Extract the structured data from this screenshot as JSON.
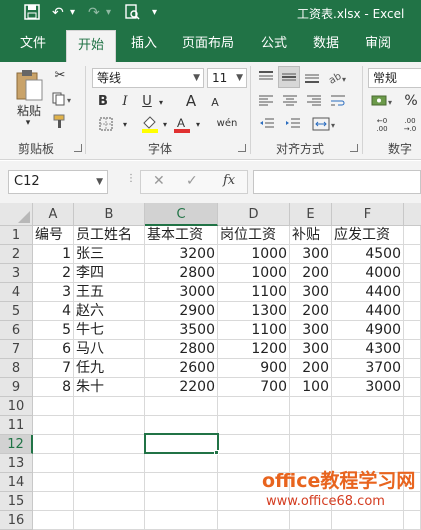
{
  "window": {
    "title": "工资表.xlsx - Excel"
  },
  "quick_access": {
    "save": "save-icon",
    "undo": "undo-icon",
    "redo": "redo-icon",
    "preview": "print-preview-icon",
    "customize": "▾"
  },
  "tabs": [
    {
      "label": "文件"
    },
    {
      "label": "开始"
    },
    {
      "label": "插入"
    },
    {
      "label": "页面布局"
    },
    {
      "label": "公式"
    },
    {
      "label": "数据"
    },
    {
      "label": "审阅"
    }
  ],
  "ribbon": {
    "clipboard": {
      "paste_label": "粘贴",
      "group_label": "剪贴板"
    },
    "font": {
      "font_name": "等线",
      "font_size": "11",
      "bold": "B",
      "italic": "I",
      "underline": "U",
      "size_up": "A",
      "size_down": "A",
      "phonetic": "wén",
      "group_label": "字体"
    },
    "alignment": {
      "group_label": "对齐方式"
    },
    "number": {
      "format": "常规",
      "percent": "%",
      "group_label": "数字"
    }
  },
  "formula_bar": {
    "name_box": "C12",
    "fx": "fx",
    "cancel": "✕",
    "enter": "✓",
    "content": ""
  },
  "sheet": {
    "columns": [
      "A",
      "B",
      "C",
      "D",
      "E",
      "F"
    ],
    "row_numbers": [
      "1",
      "2",
      "3",
      "4",
      "5",
      "6",
      "7",
      "8",
      "9",
      "10",
      "11",
      "12",
      "13",
      "14",
      "15",
      "16"
    ],
    "header": [
      "编号",
      "员工姓名",
      "基本工资",
      "岗位工资",
      "补贴",
      "应发工资"
    ],
    "rows": [
      [
        "1",
        "张三",
        "3200",
        "1000",
        "300",
        "4500"
      ],
      [
        "2",
        "李四",
        "2800",
        "1000",
        "200",
        "4000"
      ],
      [
        "3",
        "王五",
        "3000",
        "1100",
        "300",
        "4400"
      ],
      [
        "4",
        "赵六",
        "2900",
        "1300",
        "200",
        "4400"
      ],
      [
        "5",
        "牛七",
        "3500",
        "1100",
        "300",
        "4900"
      ],
      [
        "6",
        "马八",
        "2800",
        "1200",
        "300",
        "4300"
      ],
      [
        "7",
        "任九",
        "2600",
        "900",
        "200",
        "3700"
      ],
      [
        "8",
        "朱十",
        "2200",
        "700",
        "100",
        "3000"
      ]
    ],
    "selected_cell": "C12"
  },
  "watermark": {
    "line1": "office教程学习网",
    "line2": "www.office68.com"
  },
  "colors": {
    "accent": "#217346",
    "ribbon_bg": "#f3f3f3"
  }
}
